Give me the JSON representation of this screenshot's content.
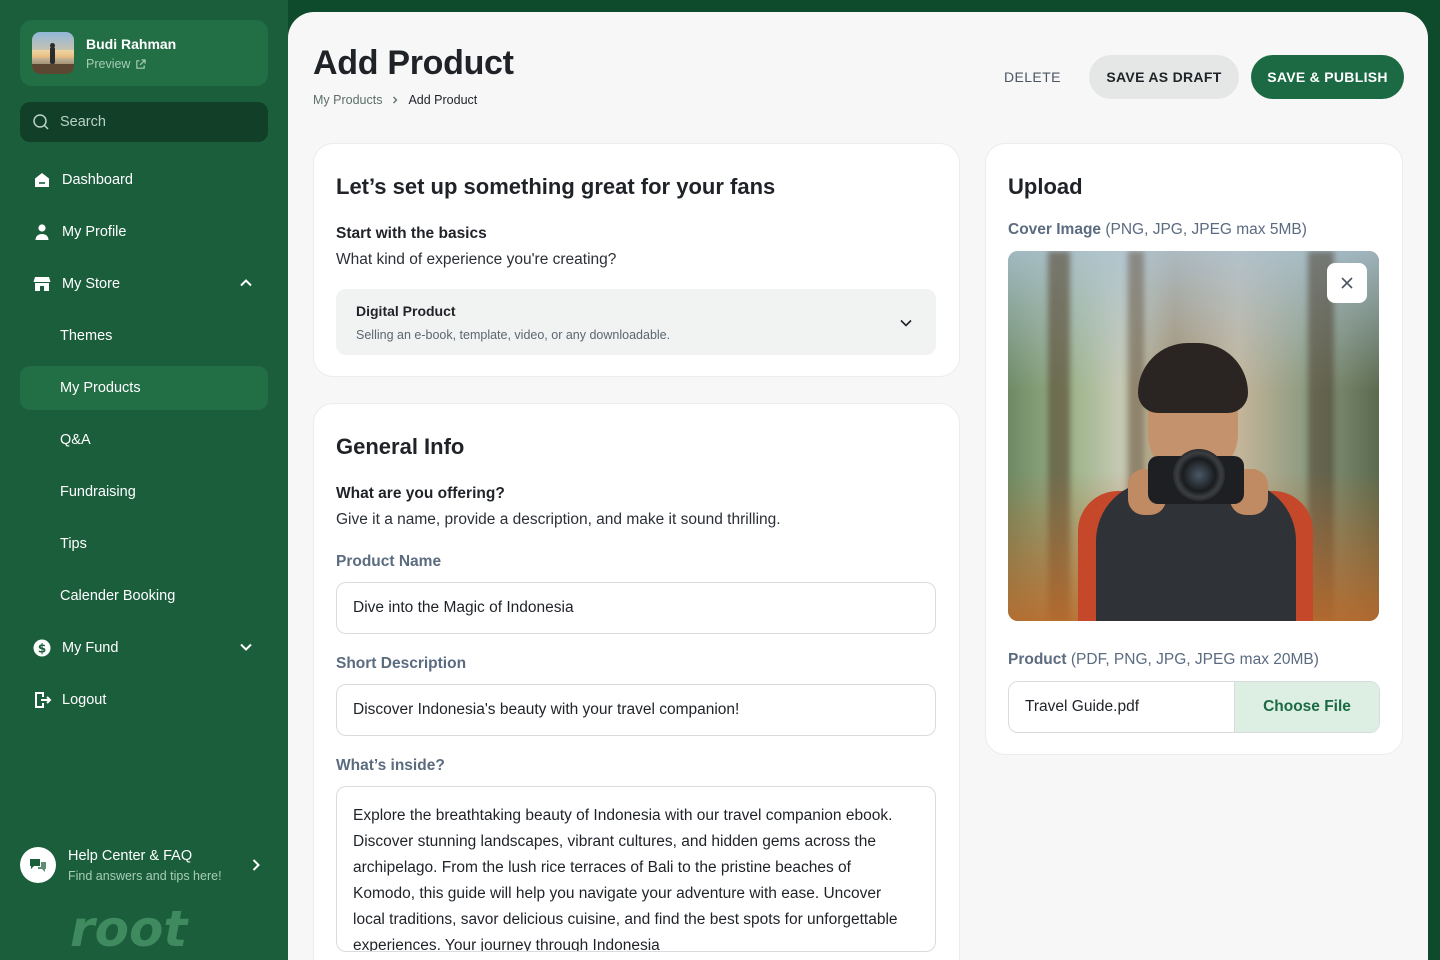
{
  "user": {
    "name": "Budi Rahman",
    "preview_label": "Preview"
  },
  "search": {
    "placeholder": "Search"
  },
  "sidebar": {
    "items": [
      {
        "label": "Dashboard",
        "icon": "home-icon"
      },
      {
        "label": "My Profile",
        "icon": "person-icon"
      },
      {
        "label": "My Store",
        "icon": "store-icon",
        "expanded": true
      },
      {
        "label": "Themes"
      },
      {
        "label": "My Products",
        "active": true
      },
      {
        "label": "Q&A"
      },
      {
        "label": "Fundraising"
      },
      {
        "label": "Tips"
      },
      {
        "label": "Calender Booking"
      },
      {
        "label": "My Fund",
        "icon": "dollar-icon",
        "expanded": false
      },
      {
        "label": "Logout",
        "icon": "logout-icon"
      }
    ],
    "help_title": "Help Center & FAQ",
    "help_subtitle": "Find answers and tips here!",
    "logo_text": "root"
  },
  "header": {
    "title": "Add Product",
    "breadcrumb": [
      "My Products",
      "Add Product"
    ],
    "delete_label": "DELETE",
    "draft_label": "SAVE AS DRAFT",
    "publish_label": "SAVE & PUBLISH"
  },
  "basics": {
    "title": "Let’s set up something great for your fans",
    "subtitle": "Start with the basics",
    "question": "What kind of experience you're creating?",
    "type_value": "Digital Product",
    "type_desc": "Selling an e-book, template, video, or any downloadable."
  },
  "general": {
    "title": "General Info",
    "subtitle": "What are you offering?",
    "desc": "Give it a name, provide a description, and make it sound thrilling.",
    "name_label": "Product Name",
    "name_value": "Dive into the Magic of Indonesia",
    "short_label": "Short Description",
    "short_value": "Discover Indonesia's beauty with your travel companion!",
    "inside_label": "What’s inside?",
    "inside_value": "Explore the breathtaking beauty of Indonesia with our travel companion ebook. Discover stunning landscapes, vibrant cultures, and hidden gems across the archipelago. From the lush rice terraces of Bali to the pristine beaches of Komodo, this guide will help you navigate your adventure with ease. Uncover local traditions, savor delicious cuisine, and find the best spots for unforgettable experiences. Your journey through Indonesia"
  },
  "upload": {
    "title": "Upload",
    "cover_label": "Cover Image",
    "cover_note": "(PNG, JPG, JPEG max 5MB)",
    "product_label": "Product",
    "product_note": "(PDF, PNG, JPG, JPEG max 20MB)",
    "file_name": "Travel Guide.pdf",
    "choose_label": "Choose File"
  },
  "colors": {
    "sidebar": "#1b5e3b",
    "accent": "#1b6a43",
    "frame": "#0e4a2c",
    "choose_bg": "#dcefe2"
  }
}
